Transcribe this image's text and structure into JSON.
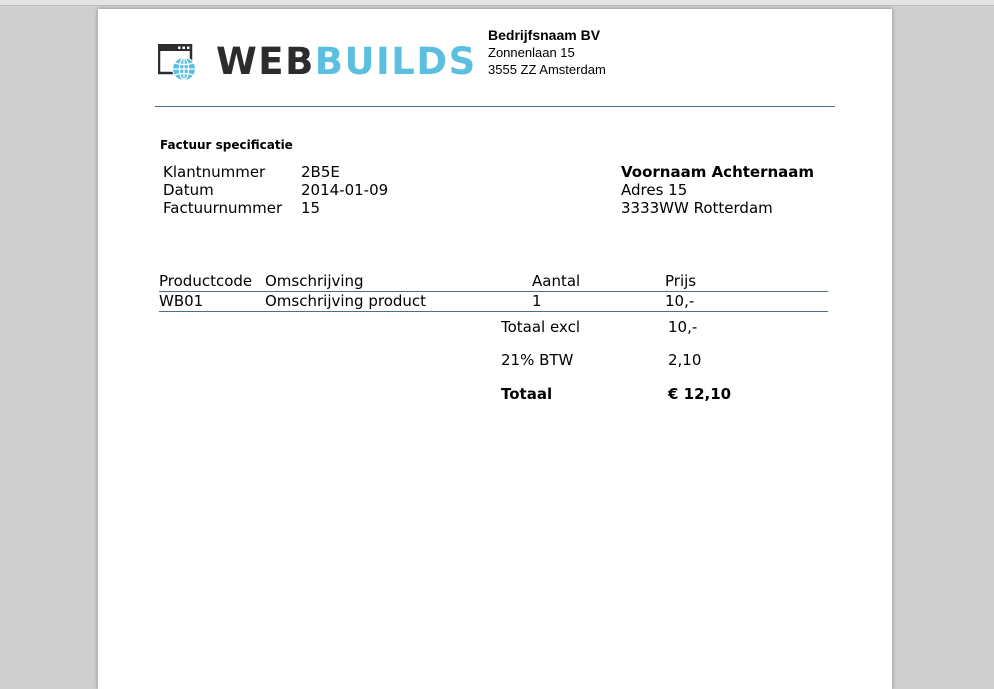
{
  "company": {
    "logo_text_1": "WEB",
    "logo_text_2": "BUILDS",
    "name": "Bedrijfsnaam BV",
    "street": "Zonnenlaan 15",
    "city": "3555 ZZ Amsterdam"
  },
  "invoice": {
    "title": "Factuur specificatie",
    "meta": [
      {
        "label": "Klantnummer",
        "value": "2B5E"
      },
      {
        "label": "Datum",
        "value": "2014-01-09"
      },
      {
        "label": "Factuurnummer",
        "value": "15"
      }
    ]
  },
  "customer": {
    "name": "Voornaam Achternaam",
    "address": "Adres 15",
    "city": "3333WW Rotterdam"
  },
  "table": {
    "headers": [
      "Productcode",
      "Omschrijving",
      "Aantal",
      "Prijs"
    ],
    "rows": [
      [
        "WB01",
        "Omschrijving product",
        "1",
        "10,-"
      ]
    ]
  },
  "totals": [
    {
      "label": "Totaal excl",
      "value": "10,-"
    },
    {
      "label": "21% BTW",
      "value": "2,10"
    },
    {
      "label": "Totaal",
      "value": "€ 12,10"
    }
  ],
  "colors": {
    "logo_dark": "#2c2c2c",
    "logo_accent": "#5bc0df",
    "rule": "#4a6f96",
    "background": "#cfcfcf"
  }
}
